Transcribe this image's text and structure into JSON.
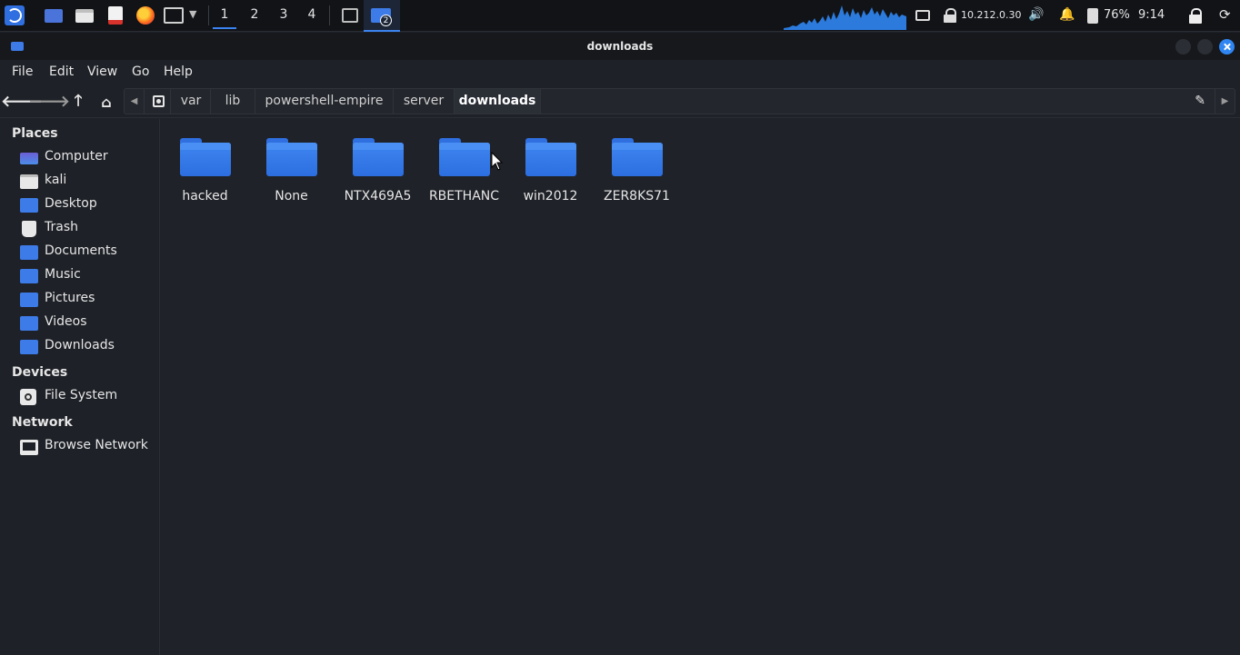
{
  "panel": {
    "workspaces": [
      "1",
      "2",
      "3",
      "4"
    ],
    "active_workspace": "1",
    "task_badge": "2",
    "ip_address": "10.212.0.30",
    "battery": "76%",
    "clock": "9:14"
  },
  "window": {
    "title": "downloads"
  },
  "menu": [
    "File",
    "Edit",
    "View",
    "Go",
    "Help"
  ],
  "path": {
    "segments": [
      "var",
      "lib",
      "powershell-empire",
      "server",
      "downloads"
    ]
  },
  "sidebar": {
    "places_title": "Places",
    "places": [
      "Computer",
      "kali",
      "Desktop",
      "Trash",
      "Documents",
      "Music",
      "Pictures",
      "Videos",
      "Downloads"
    ],
    "devices_title": "Devices",
    "devices": [
      "File System"
    ],
    "network_title": "Network",
    "network": [
      "Browse Network"
    ]
  },
  "files": [
    "hacked",
    "None",
    "NTX469A5",
    "RBETHANC",
    "win2012",
    "ZER8KS71"
  ],
  "colors": {
    "accent": "#3b83f0",
    "folder": "#3f86f0",
    "background": "#1f2228"
  }
}
